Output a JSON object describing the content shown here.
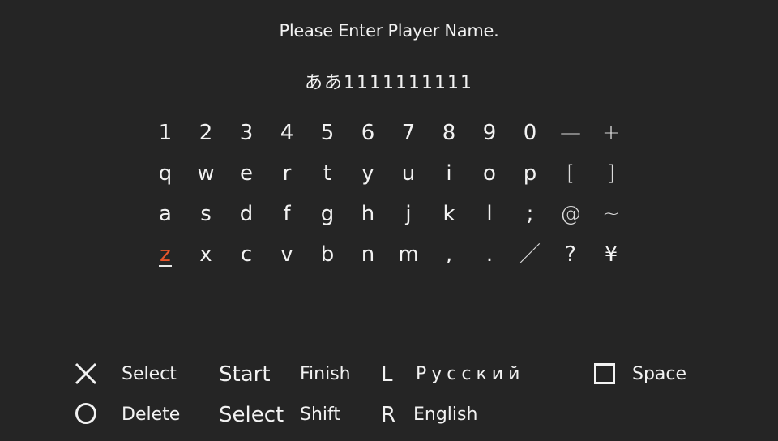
{
  "title": "Please Enter Player Name.",
  "name_entry": {
    "value": "ああ1111111111"
  },
  "keyboard": {
    "selected_key": "z",
    "selected_color": "#e8552a",
    "rows": [
      [
        "1",
        "2",
        "3",
        "4",
        "5",
        "6",
        "7",
        "8",
        "9",
        "0",
        "—",
        "+"
      ],
      [
        "q",
        "w",
        "e",
        "r",
        "t",
        "y",
        "u",
        "i",
        "o",
        "p",
        "[",
        "]"
      ],
      [
        "a",
        "s",
        "d",
        "f",
        "g",
        "h",
        "j",
        "k",
        "l",
        ";",
        "@",
        "~"
      ],
      [
        "z",
        "x",
        "c",
        "v",
        "b",
        "n",
        "m",
        ",",
        ".",
        "／",
        "?",
        "¥"
      ]
    ]
  },
  "controls": {
    "cross": {
      "icon": "cross-icon",
      "label": "Select"
    },
    "circle": {
      "icon": "circle-icon",
      "label": "Delete"
    },
    "start": {
      "button": "Start",
      "label": "Finish"
    },
    "select": {
      "button": "Select",
      "label": "Shift"
    },
    "l": {
      "button": "L",
      "label": "Русский"
    },
    "r": {
      "button": "R",
      "label": "English"
    },
    "square": {
      "icon": "square-icon",
      "label": "Space"
    }
  }
}
